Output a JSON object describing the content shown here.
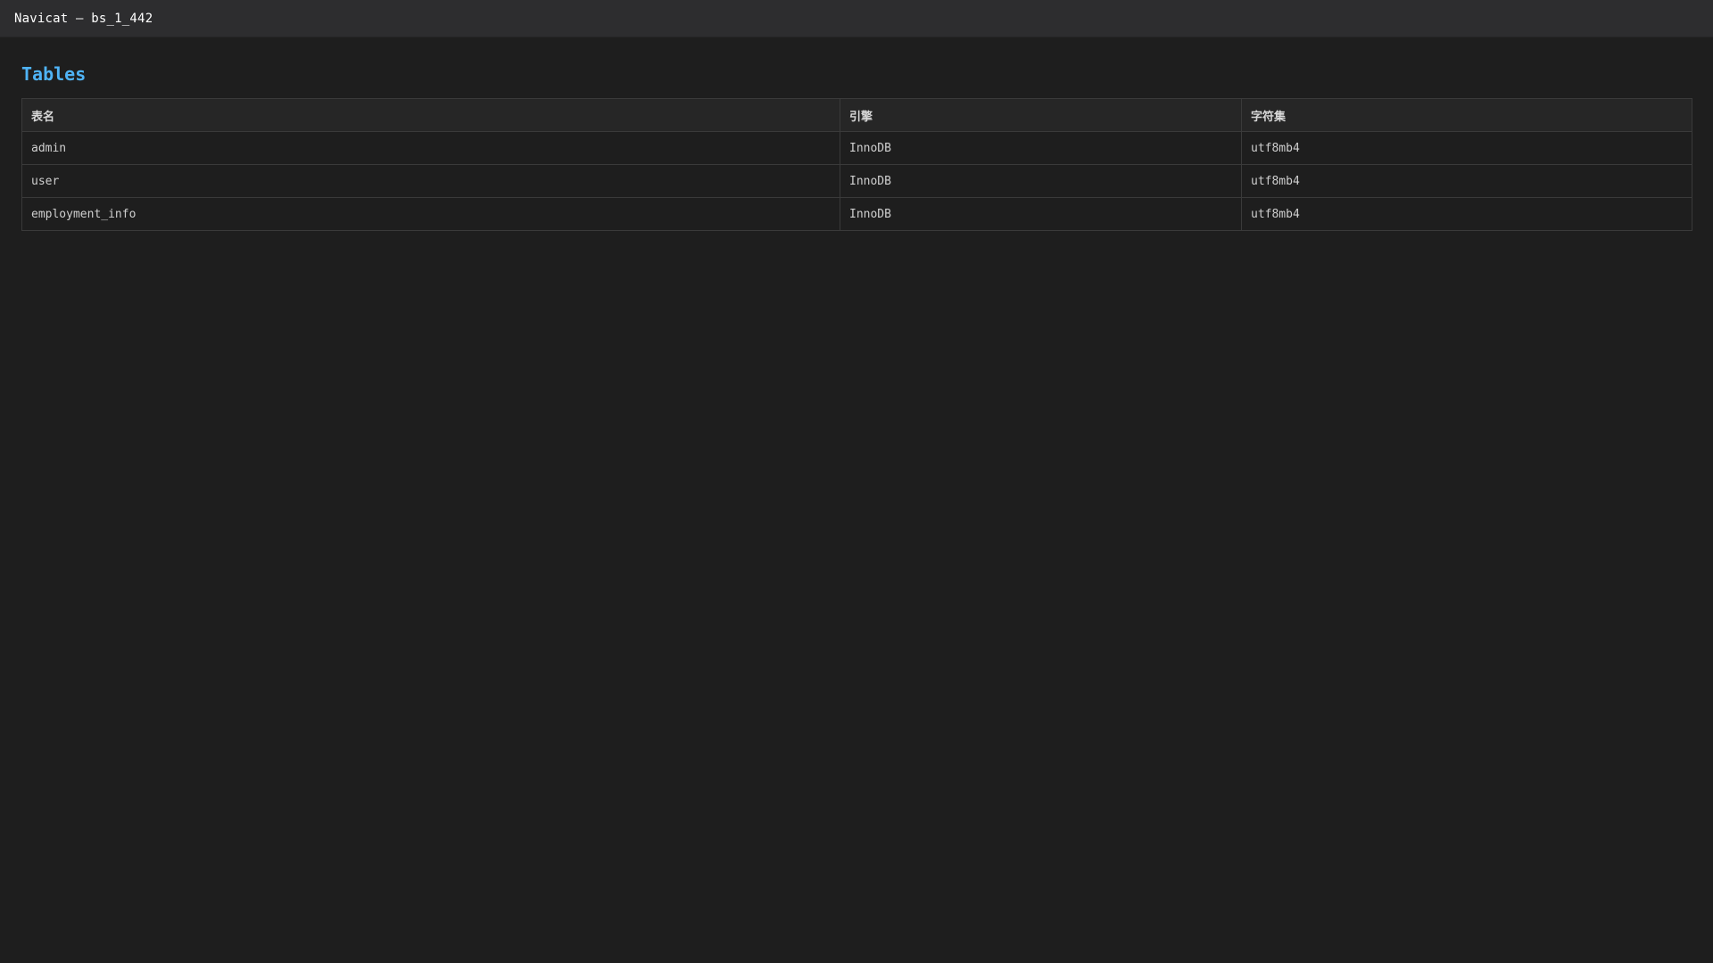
{
  "window": {
    "title": "Navicat — bs_1_442"
  },
  "main": {
    "section_title": "Tables",
    "table": {
      "columns": [
        "表名",
        "引擎",
        "字符集"
      ],
      "rows": [
        {
          "name": "admin",
          "engine": "InnoDB",
          "charset": "utf8mb4"
        },
        {
          "name": "user",
          "engine": "InnoDB",
          "charset": "utf8mb4"
        },
        {
          "name": "employment_info",
          "engine": "InnoDB",
          "charset": "utf8mb4"
        }
      ]
    }
  },
  "colors": {
    "background": "#1e1e1e",
    "titlebar": "#2d2d2f",
    "accent": "#4fb3f6",
    "border": "#3a3a3a"
  }
}
